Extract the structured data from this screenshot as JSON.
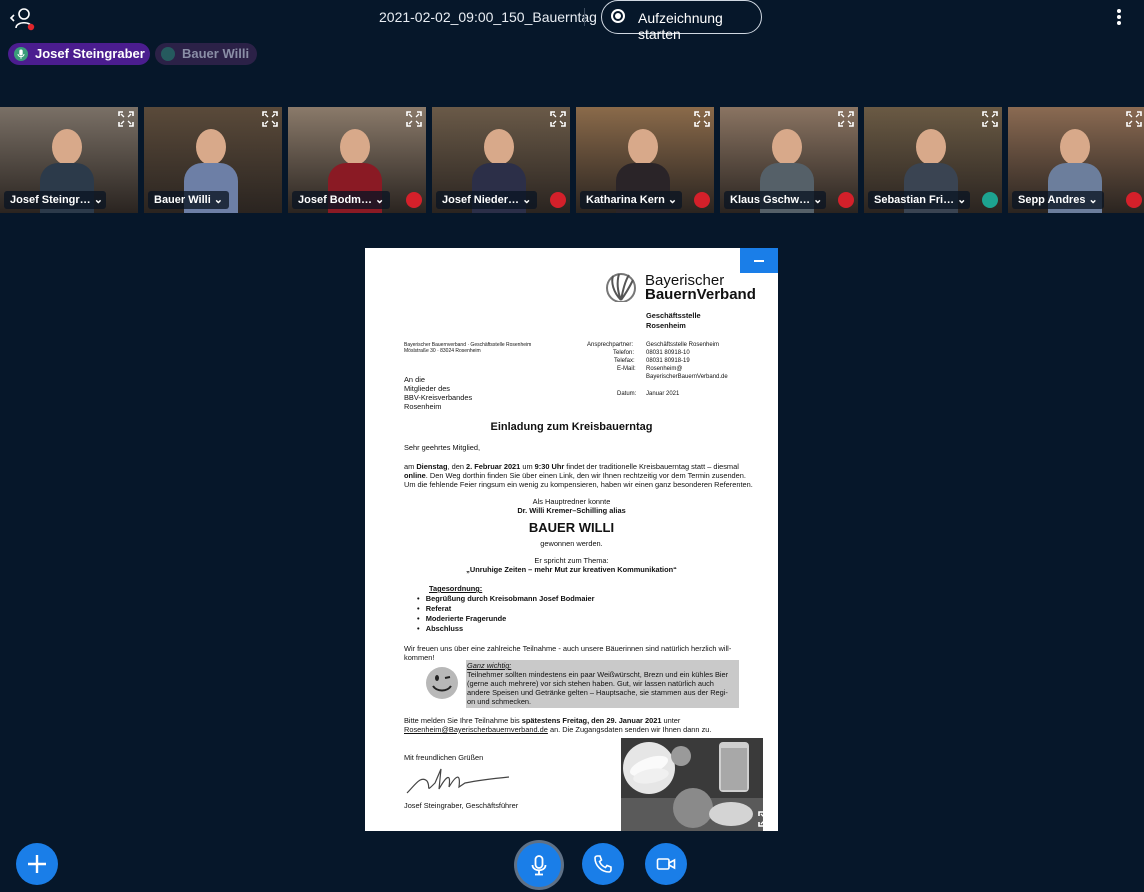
{
  "header": {
    "meeting_title": "2021-02-02_09:00_150_Bauerntag",
    "record_label": "Aufzeichnung starten"
  },
  "talkers": [
    {
      "name": "Josef Steingraber",
      "active": true
    },
    {
      "name": "Bauer Willi",
      "active": false
    }
  ],
  "webcams": [
    {
      "name": "Josef Steingr…",
      "muted": false,
      "bg": "#7a7066",
      "shirt": "#2c3a4a"
    },
    {
      "name": "Bauer Willi",
      "muted": false,
      "bg": "#5a4a3a",
      "shirt": "#6d7fa6"
    },
    {
      "name": "Josef Bodm…",
      "muted": true,
      "bg": "#8a7a6a",
      "shirt": "#8a1a24"
    },
    {
      "name": "Josef Nieder…",
      "muted": true,
      "bg": "#6a5a48",
      "shirt": "#2c2f48"
    },
    {
      "name": "Katharina Kern",
      "muted": true,
      "bg": "#8a6a4a",
      "shirt": "#2a2428"
    },
    {
      "name": "Klaus Gschw…",
      "muted": true,
      "bg": "#8a7462",
      "shirt": "#556068"
    },
    {
      "name": "Sebastian Fri…",
      "muted": false,
      "listen": true,
      "bg": "#6a5a44",
      "shirt": "#3a4452"
    },
    {
      "name": "Sepp Andres",
      "muted": true,
      "bg": "#8a6a52",
      "shirt": "#6c7e9c"
    }
  ],
  "document": {
    "logo_line1": "Bayerischer",
    "logo_line2": "BauernVerband",
    "office1": "Geschäftsstelle",
    "office2": "Rosenheim",
    "sender_line1": "Bayerischer Bauernverband · Geschäftsstelle Rosenheim",
    "sender_line2": "Mösl­straße 30 · 83024 Rosenheim",
    "contact_labels": [
      "Ansprechpartner:",
      "Telefon:",
      "Telefax:",
      "E-Mail:"
    ],
    "contact_values": [
      "Geschäftsstelle Rosenheim",
      "08031 80918-10",
      "08031 80918-19",
      "Rosenheim@",
      "BayerischerBauernVerband.de"
    ],
    "date_label": "Datum:",
    "date_value": "Januar 2021",
    "recipient": [
      "An die",
      "Mitglieder des",
      "BBV-Kreisverbandes",
      "Rosenheim"
    ],
    "headline": "Einladung zum Kreisbauerntag",
    "salutation": "Sehr geehrtes Mitglied,",
    "p1_line1_a": "am ",
    "p1_line1_b": "Dienstag",
    "p1_line1_c": ", den ",
    "p1_line1_d": "2. Februar 2021",
    "p1_line1_e": " um ",
    "p1_line1_f": "9:30 Uhr",
    "p1_line1_g": " findet der traditionelle Kreisbauerntag statt – diesmal",
    "p1_line2_a": "online",
    "p1_line2_b": ". Den Weg dorthin finden Sie über einen Link, den wir Ihnen rechtzeitig vor dem Termin zusenden.",
    "p1_line3": "Um die fehlende Feier ringsum ein wenig zu kompensieren, haben wir einen ganz besonderen Referenten.",
    "speaker_intro": "Als Hauptredner konnte",
    "speaker_name": "Dr. Willi Kremer–Schilling alias",
    "speaker_alias": "BAUER WILLI",
    "won": "gewonnen werden.",
    "topic_intro": "Er spricht zum Thema:",
    "topic": "„Unruhige Zeiten – mehr Mut zur kreativen Kommunikation“",
    "agenda_title": "Tagesordnung:",
    "agenda": [
      "Begrüßung durch Kreisobmann Josef Bodmaier",
      "Referat",
      "Moderierte Fragerunde",
      "Abschluss"
    ],
    "closing1": "Wir freuen uns über eine zahlreiche Teilnahme - auch unsere Bäuerinnen sind natürlich herzlich will-",
    "closing2": "kommen!",
    "note_title": "Ganz wichtig:",
    "note_lines": [
      "Teilnehmer sollten mindestens ein paar Weißwürscht, Brezn und ein kühles Bier",
      "(gerne auch mehrere) vor sich stehen haben. Gut, wir lassen natürlich auch",
      "andere Speisen und Getränke gelten – Hauptsache, sie stammen aus der Regi-",
      "on und schmecken."
    ],
    "register_a": "Bitte melden Sie Ihre Teilnahme bis ",
    "register_b": "spätestens Freitag, den 29. Januar 2021",
    "register_c": " unter",
    "register_email": "Rosenheim@Bayerischerbauernverband.de",
    "register_d": " an. Die Zugangsdaten senden wir Ihnen dann zu.",
    "greeting": "Mit freundlichen Grüßen",
    "signatory": "Josef Steingraber, Geschäftsführer"
  }
}
